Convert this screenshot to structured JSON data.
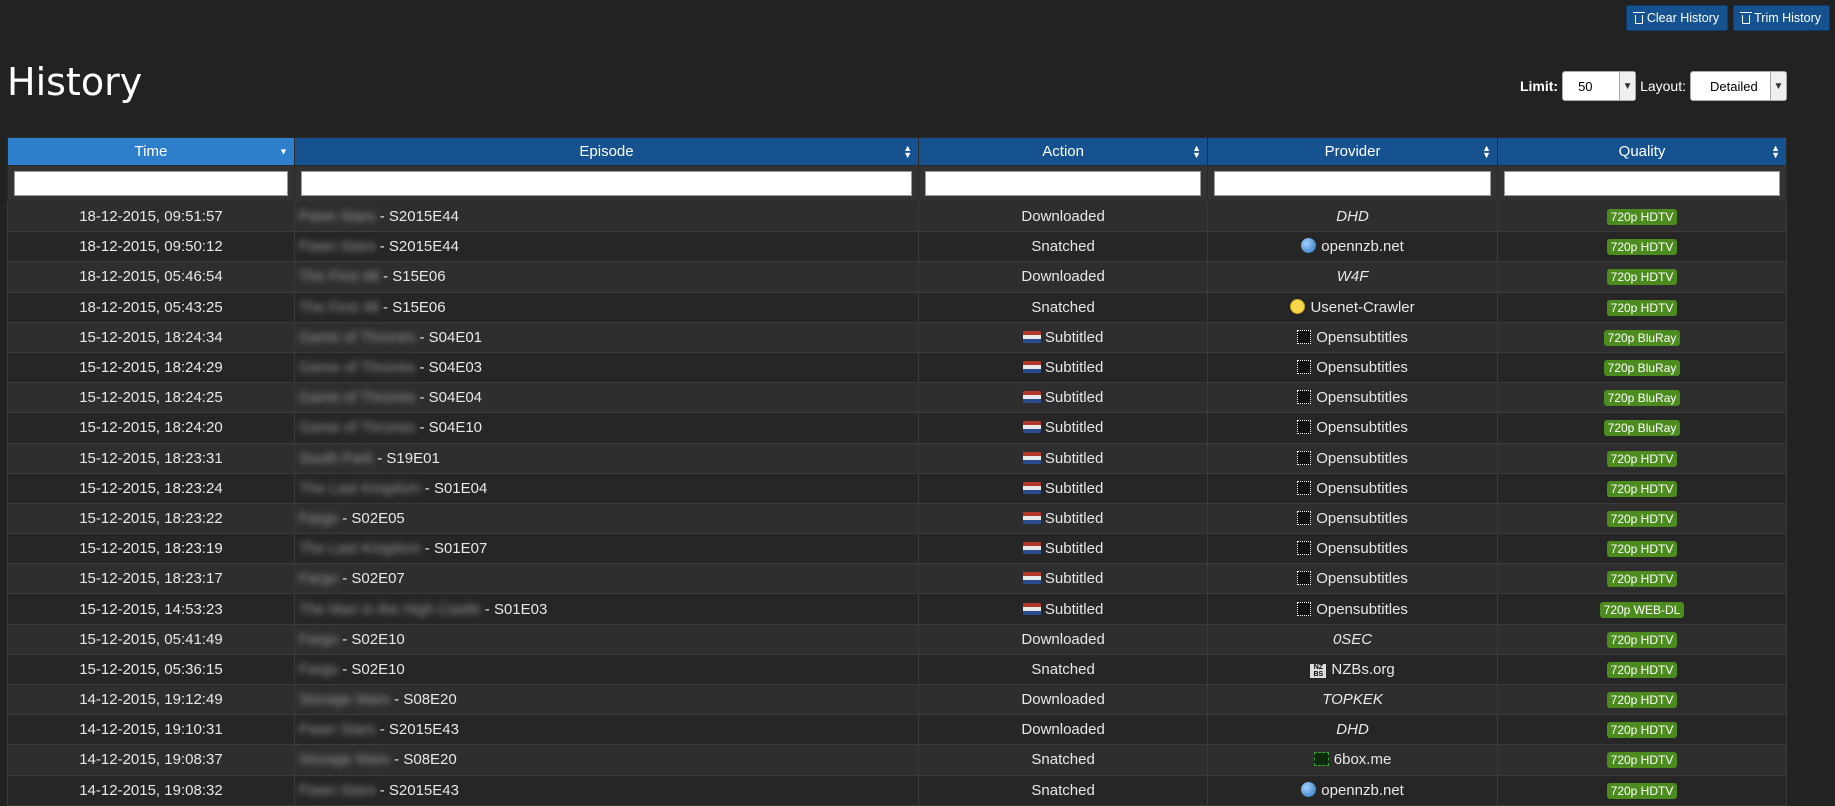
{
  "toolbar": {
    "clear_label": "Clear History",
    "trim_label": "Trim History"
  },
  "page": {
    "title": "History"
  },
  "controls": {
    "limit_label": "Limit:",
    "limit_value": "50",
    "layout_label": "Layout:",
    "layout_value": "Detailed"
  },
  "table": {
    "columns": [
      "Time",
      "Episode",
      "Action",
      "Provider",
      "Quality"
    ],
    "rows": [
      {
        "time": "18-12-2015, 09:51:57",
        "show": "Pawn Stars",
        "ep": " - S2015E44",
        "flag": false,
        "action": "Downloaded",
        "provider": "DHD",
        "provider_icon": "",
        "italic": true,
        "quality": "720p HDTV"
      },
      {
        "time": "18-12-2015, 09:50:12",
        "show": "Pawn Stars",
        "ep": " - S2015E44",
        "flag": false,
        "action": "Snatched",
        "provider": "opennzb.net",
        "provider_icon": "globe-icon",
        "italic": false,
        "quality": "720p HDTV"
      },
      {
        "time": "18-12-2015, 05:46:54",
        "show": "The First 48",
        "ep": " - S15E06",
        "flag": false,
        "action": "Downloaded",
        "provider": "W4F",
        "provider_icon": "",
        "italic": true,
        "quality": "720p HDTV"
      },
      {
        "time": "18-12-2015, 05:43:25",
        "show": "The First 48",
        "ep": " - S15E06",
        "flag": false,
        "action": "Snatched",
        "provider": "Usenet-Crawler",
        "provider_icon": "smiley-icon",
        "italic": false,
        "quality": "720p HDTV"
      },
      {
        "time": "15-12-2015, 18:24:34",
        "show": "Game of Thrones",
        "ep": " - S04E01",
        "flag": true,
        "action": "Subtitled",
        "provider": "Opensubtitles",
        "provider_icon": "opensubtitles-icon",
        "italic": false,
        "quality": "720p BluRay"
      },
      {
        "time": "15-12-2015, 18:24:29",
        "show": "Game of Thrones",
        "ep": " - S04E03",
        "flag": true,
        "action": "Subtitled",
        "provider": "Opensubtitles",
        "provider_icon": "opensubtitles-icon",
        "italic": false,
        "quality": "720p BluRay"
      },
      {
        "time": "15-12-2015, 18:24:25",
        "show": "Game of Thrones",
        "ep": " - S04E04",
        "flag": true,
        "action": "Subtitled",
        "provider": "Opensubtitles",
        "provider_icon": "opensubtitles-icon",
        "italic": false,
        "quality": "720p BluRay"
      },
      {
        "time": "15-12-2015, 18:24:20",
        "show": "Game of Thrones",
        "ep": " - S04E10",
        "flag": true,
        "action": "Subtitled",
        "provider": "Opensubtitles",
        "provider_icon": "opensubtitles-icon",
        "italic": false,
        "quality": "720p BluRay"
      },
      {
        "time": "15-12-2015, 18:23:31",
        "show": "South Park",
        "ep": " - S19E01",
        "flag": true,
        "action": "Subtitled",
        "provider": "Opensubtitles",
        "provider_icon": "opensubtitles-icon",
        "italic": false,
        "quality": "720p HDTV"
      },
      {
        "time": "15-12-2015, 18:23:24",
        "show": "The Last Kingdom",
        "ep": " - S01E04",
        "flag": true,
        "action": "Subtitled",
        "provider": "Opensubtitles",
        "provider_icon": "opensubtitles-icon",
        "italic": false,
        "quality": "720p HDTV"
      },
      {
        "time": "15-12-2015, 18:23:22",
        "show": "Fargo",
        "ep": " - S02E05",
        "flag": true,
        "action": "Subtitled",
        "provider": "Opensubtitles",
        "provider_icon": "opensubtitles-icon",
        "italic": false,
        "quality": "720p HDTV"
      },
      {
        "time": "15-12-2015, 18:23:19",
        "show": "The Last Kingdom",
        "ep": " - S01E07",
        "flag": true,
        "action": "Subtitled",
        "provider": "Opensubtitles",
        "provider_icon": "opensubtitles-icon",
        "italic": false,
        "quality": "720p HDTV"
      },
      {
        "time": "15-12-2015, 18:23:17",
        "show": "Fargo",
        "ep": " - S02E07",
        "flag": true,
        "action": "Subtitled",
        "provider": "Opensubtitles",
        "provider_icon": "opensubtitles-icon",
        "italic": false,
        "quality": "720p HDTV"
      },
      {
        "time": "15-12-2015, 14:53:23",
        "show": "The Man in the High Castle",
        "ep": " - S01E03",
        "flag": true,
        "action": "Subtitled",
        "provider": "Opensubtitles",
        "provider_icon": "opensubtitles-icon",
        "italic": false,
        "quality": "720p WEB-DL"
      },
      {
        "time": "15-12-2015, 05:41:49",
        "show": "Fargo",
        "ep": " - S02E10",
        "flag": false,
        "action": "Downloaded",
        "provider": "0SEC",
        "provider_icon": "",
        "italic": true,
        "quality": "720p HDTV"
      },
      {
        "time": "15-12-2015, 05:36:15",
        "show": "Fargo",
        "ep": " - S02E10",
        "flag": false,
        "action": "Snatched",
        "provider": "NZBs.org",
        "provider_icon": "nzbs-icon",
        "italic": false,
        "quality": "720p HDTV"
      },
      {
        "time": "14-12-2015, 19:12:49",
        "show": "Storage Wars",
        "ep": " - S08E20",
        "flag": false,
        "action": "Downloaded",
        "provider": "TOPKEK",
        "provider_icon": "",
        "italic": true,
        "quality": "720p HDTV"
      },
      {
        "time": "14-12-2015, 19:10:31",
        "show": "Pawn Stars",
        "ep": " - S2015E43",
        "flag": false,
        "action": "Downloaded",
        "provider": "DHD",
        "provider_icon": "",
        "italic": true,
        "quality": "720p HDTV"
      },
      {
        "time": "14-12-2015, 19:08:37",
        "show": "Storage Wars",
        "ep": " - S08E20",
        "flag": false,
        "action": "Snatched",
        "provider": "6box.me",
        "provider_icon": "sixbox-icon",
        "italic": false,
        "quality": "720p HDTV"
      },
      {
        "time": "14-12-2015, 19:08:32",
        "show": "Pawn Stars",
        "ep": " - S2015E43",
        "flag": false,
        "action": "Snatched",
        "provider": "opennzb.net",
        "provider_icon": "globe-icon",
        "italic": false,
        "quality": "720p HDTV"
      }
    ]
  },
  "colors": {
    "background": "#222222",
    "header": "#15528f",
    "header_active": "#2d7fcc",
    "quality_badge": "#4c8c1e"
  }
}
